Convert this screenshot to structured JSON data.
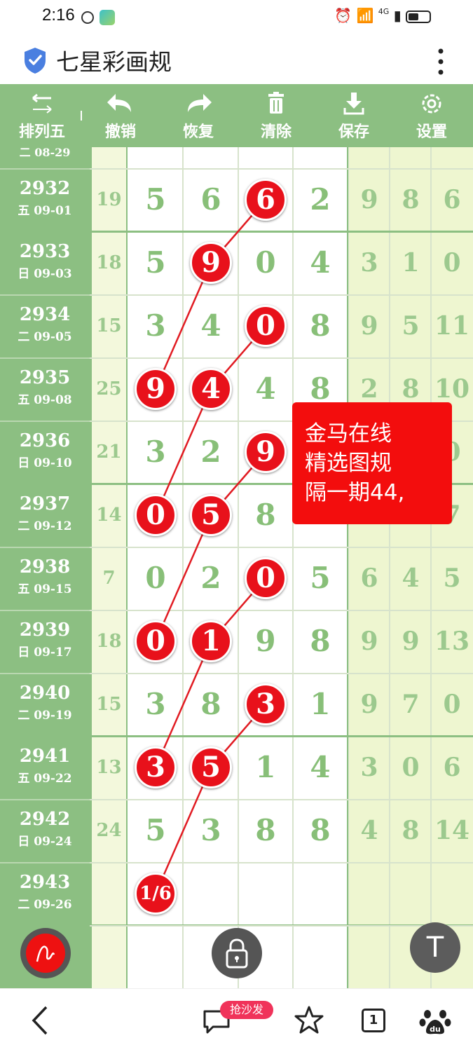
{
  "status_bar": {
    "time": "2:16",
    "network": "4G"
  },
  "header": {
    "title": "七星彩画规"
  },
  "toolbar": {
    "items": [
      {
        "label": "排列五",
        "icon": "swap-arrows-icon"
      },
      {
        "label": "撤销",
        "icon": "undo-icon"
      },
      {
        "label": "恢复",
        "icon": "redo-icon"
      },
      {
        "label": "清除",
        "icon": "trash-icon"
      },
      {
        "label": "保存",
        "icon": "download-icon"
      },
      {
        "label": "设置",
        "icon": "gear-icon"
      }
    ]
  },
  "grid": {
    "partial_top_label": "二 08-29",
    "rows": [
      {
        "issue": "2932",
        "date": "五 09-01",
        "sum": "19",
        "digits": [
          "5",
          "6",
          "6",
          "2"
        ],
        "right": [
          "9",
          "8",
          "6"
        ]
      },
      {
        "issue": "2933",
        "date": "日 09-03",
        "sum": "18",
        "digits": [
          "5",
          "9",
          "0",
          "4"
        ],
        "right": [
          "3",
          "1",
          "0"
        ]
      },
      {
        "issue": "2934",
        "date": "二 09-05",
        "sum": "15",
        "digits": [
          "3",
          "4",
          "0",
          "8"
        ],
        "right": [
          "9",
          "5",
          "11"
        ]
      },
      {
        "issue": "2935",
        "date": "五 09-08",
        "sum": "25",
        "digits": [
          "9",
          "4",
          "4",
          "8"
        ],
        "right": [
          "2",
          "8",
          "10"
        ]
      },
      {
        "issue": "2936",
        "date": "日 09-10",
        "sum": "21",
        "digits": [
          "3",
          "2",
          "9",
          ""
        ],
        "right": [
          "",
          "",
          "0"
        ]
      },
      {
        "issue": "2937",
        "date": "二 09-12",
        "sum": "14",
        "digits": [
          "0",
          "5",
          "8",
          ""
        ],
        "right": [
          "",
          "",
          "7"
        ]
      },
      {
        "issue": "2938",
        "date": "五 09-15",
        "sum": "7",
        "digits": [
          "0",
          "2",
          "0",
          "5"
        ],
        "right": [
          "6",
          "4",
          "5"
        ]
      },
      {
        "issue": "2939",
        "date": "日 09-17",
        "sum": "18",
        "digits": [
          "0",
          "1",
          "9",
          "8"
        ],
        "right": [
          "9",
          "9",
          "13"
        ]
      },
      {
        "issue": "2940",
        "date": "二 09-19",
        "sum": "15",
        "digits": [
          "3",
          "8",
          "3",
          "1"
        ],
        "right": [
          "9",
          "7",
          "0"
        ]
      },
      {
        "issue": "2941",
        "date": "五 09-22",
        "sum": "13",
        "digits": [
          "3",
          "5",
          "1",
          "4"
        ],
        "right": [
          "3",
          "0",
          "6"
        ]
      },
      {
        "issue": "2942",
        "date": "日 09-24",
        "sum": "24",
        "digits": [
          "5",
          "3",
          "8",
          "8"
        ],
        "right": [
          "4",
          "8",
          "14"
        ]
      },
      {
        "issue": "2943",
        "date": "二 09-26",
        "sum": "",
        "digits": [
          "",
          "",
          "",
          ""
        ],
        "right": [
          "",
          "",
          ""
        ]
      }
    ],
    "highlight_balls": [
      {
        "row": 0,
        "col": 2,
        "text": "6"
      },
      {
        "row": 1,
        "col": 1,
        "text": "9"
      },
      {
        "row": 2,
        "col": 2,
        "text": "0"
      },
      {
        "row": 3,
        "col": 0,
        "text": "9"
      },
      {
        "row": 3,
        "col": 1,
        "text": "4"
      },
      {
        "row": 4,
        "col": 2,
        "text": "9"
      },
      {
        "row": 5,
        "col": 0,
        "text": "0"
      },
      {
        "row": 5,
        "col": 1,
        "text": "5"
      },
      {
        "row": 6,
        "col": 2,
        "text": "0"
      },
      {
        "row": 7,
        "col": 0,
        "text": "0"
      },
      {
        "row": 7,
        "col": 1,
        "text": "1"
      },
      {
        "row": 8,
        "col": 2,
        "text": "3"
      },
      {
        "row": 9,
        "col": 0,
        "text": "3"
      },
      {
        "row": 9,
        "col": 1,
        "text": "5"
      },
      {
        "row": 11,
        "col": 0,
        "text": "1/6"
      }
    ],
    "connections": [
      [
        [
          0,
          2
        ],
        [
          1,
          1
        ]
      ],
      [
        [
          1,
          1
        ],
        [
          3,
          0
        ]
      ],
      [
        [
          2,
          2
        ],
        [
          3,
          1
        ]
      ],
      [
        [
          3,
          1
        ],
        [
          5,
          0
        ]
      ],
      [
        [
          4,
          2
        ],
        [
          5,
          1
        ]
      ],
      [
        [
          5,
          1
        ],
        [
          7,
          0
        ]
      ],
      [
        [
          6,
          2
        ],
        [
          7,
          1
        ]
      ],
      [
        [
          7,
          1
        ],
        [
          9,
          0
        ]
      ],
      [
        [
          8,
          2
        ],
        [
          9,
          1
        ]
      ],
      [
        [
          9,
          1
        ],
        [
          11,
          0
        ]
      ]
    ],
    "line_color": "#e11b22"
  },
  "note": {
    "lines": [
      "金马在线",
      "精选图规",
      "隔一期44,"
    ]
  },
  "floating": {
    "top_button_label": "T"
  },
  "bottom_nav": {
    "badge": "抢沙发",
    "tab_count": "1"
  },
  "colors": {
    "accent_green": "#8cbf82",
    "ball_red": "#e8111b",
    "note_red": "#f30d0d"
  }
}
